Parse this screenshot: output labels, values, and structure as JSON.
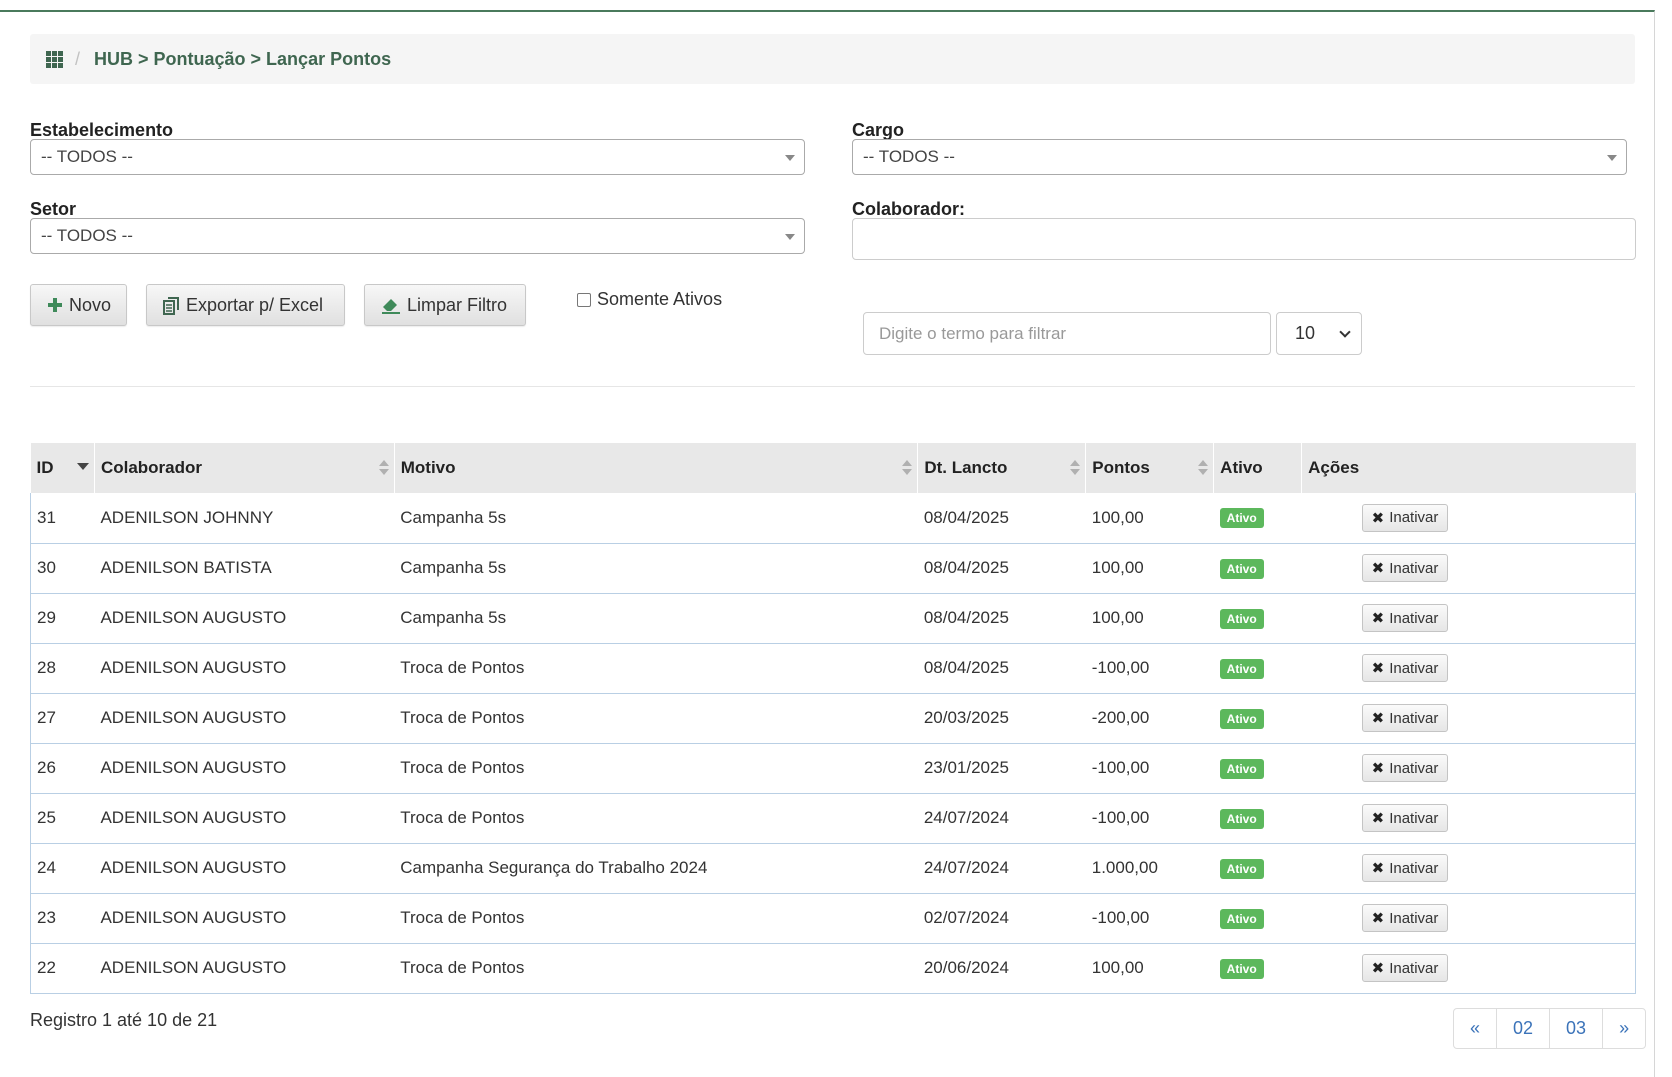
{
  "breadcrumb": {
    "separator": "/",
    "path": "HUB > Pontuação > Lançar Pontos"
  },
  "filters": {
    "estabelecimento": {
      "label": "Estabelecimento",
      "value": "-- TODOS --"
    },
    "cargo": {
      "label": "Cargo",
      "value": "-- TODOS --"
    },
    "setor": {
      "label": "Setor",
      "value": "-- TODOS --"
    },
    "colaborador": {
      "label": "Colaborador:",
      "value": ""
    },
    "somente_ativos": {
      "label": "Somente Ativos",
      "checked": false
    },
    "search_placeholder": "Digite o termo para filtrar",
    "page_size": "10"
  },
  "toolbar": {
    "novo": "Novo",
    "exportar": "Exportar p/ Excel",
    "limpar": "Limpar Filtro"
  },
  "table": {
    "columns": [
      "ID",
      "Colaborador",
      "Motivo",
      "Dt. Lancto",
      "Pontos",
      "Ativo",
      "Ações"
    ],
    "rows": [
      {
        "id": "31",
        "colaborador": "ADENILSON JOHNNY",
        "motivo": "Campanha 5s",
        "data": "08/04/2025",
        "pontos": "100,00",
        "ativo": "Ativo",
        "acao": "Inativar"
      },
      {
        "id": "30",
        "colaborador": "ADENILSON BATISTA",
        "motivo": "Campanha 5s",
        "data": "08/04/2025",
        "pontos": "100,00",
        "ativo": "Ativo",
        "acao": "Inativar"
      },
      {
        "id": "29",
        "colaborador": "ADENILSON AUGUSTO",
        "motivo": "Campanha 5s",
        "data": "08/04/2025",
        "pontos": "100,00",
        "ativo": "Ativo",
        "acao": "Inativar"
      },
      {
        "id": "28",
        "colaborador": "ADENILSON AUGUSTO",
        "motivo": "Troca de Pontos",
        "data": "08/04/2025",
        "pontos": "-100,00",
        "ativo": "Ativo",
        "acao": "Inativar"
      },
      {
        "id": "27",
        "colaborador": "ADENILSON AUGUSTO",
        "motivo": "Troca de Pontos",
        "data": "20/03/2025",
        "pontos": "-200,00",
        "ativo": "Ativo",
        "acao": "Inativar"
      },
      {
        "id": "26",
        "colaborador": "ADENILSON AUGUSTO",
        "motivo": "Troca de Pontos",
        "data": "23/01/2025",
        "pontos": "-100,00",
        "ativo": "Ativo",
        "acao": "Inativar"
      },
      {
        "id": "25",
        "colaborador": "ADENILSON AUGUSTO",
        "motivo": "Troca de Pontos",
        "data": "24/07/2024",
        "pontos": "-100,00",
        "ativo": "Ativo",
        "acao": "Inativar"
      },
      {
        "id": "24",
        "colaborador": "ADENILSON AUGUSTO",
        "motivo": "Campanha Segurança do Trabalho 2024",
        "data": "24/07/2024",
        "pontos": "1.000,00",
        "ativo": "Ativo",
        "acao": "Inativar"
      },
      {
        "id": "23",
        "colaborador": "ADENILSON AUGUSTO",
        "motivo": "Troca de Pontos",
        "data": "02/07/2024",
        "pontos": "-100,00",
        "ativo": "Ativo",
        "acao": "Inativar"
      },
      {
        "id": "22",
        "colaborador": "ADENILSON AUGUSTO",
        "motivo": "Troca de Pontos",
        "data": "20/06/2024",
        "pontos": "100,00",
        "ativo": "Ativo",
        "acao": "Inativar"
      }
    ]
  },
  "footer": {
    "info": "Registro 1 até 10 de 21",
    "pagination": [
      "«",
      "02",
      "03",
      "»"
    ]
  },
  "colors": {
    "accent": "#3f6650",
    "badge": "#5cb85c",
    "link": "#3b73b9"
  },
  "icons": {
    "breadcrumb": "apps-grid-icon",
    "novo": "plus-icon",
    "exportar": "copy-icon",
    "limpar": "eraser-icon",
    "inativar": "close-icon"
  }
}
